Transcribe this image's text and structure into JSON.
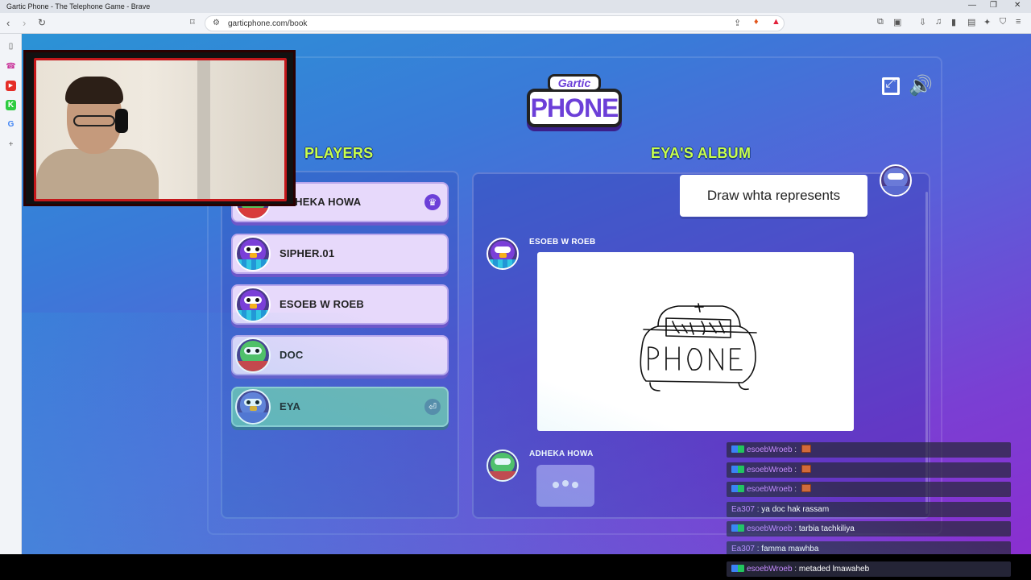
{
  "browser": {
    "window_title": "Gartic Phone - The Telephone Game - Brave",
    "url": "garticphone.com/book",
    "window_controls": {
      "minimize": "—",
      "restore": "❐",
      "close": "✕"
    }
  },
  "game": {
    "logo_top": "Gartic",
    "logo_bottom": "PHONE",
    "players_heading": "PLAYERS",
    "album_heading": "EYA'S ALBUM",
    "players": [
      {
        "name": "ADHEKA HOWA",
        "badge": "♛"
      },
      {
        "name": "SIPHER.01"
      },
      {
        "name": "ESOEB W ROEB"
      },
      {
        "name": "DOC"
      },
      {
        "name": "EYA",
        "badge": "⏎"
      }
    ],
    "album": {
      "prompt": "Draw whta represents",
      "entries": [
        {
          "author": "ESOEB W ROEB",
          "type": "drawing"
        },
        {
          "author": "ADHEKA HOWA",
          "type": "typing"
        }
      ]
    }
  },
  "chat": [
    {
      "user": "esoebWroeb",
      "message": "",
      "emote": true,
      "user_color": "#c58bff"
    },
    {
      "user": "esoebWroeb",
      "message": "",
      "emote": true,
      "user_color": "#c58bff"
    },
    {
      "user": "esoebWroeb",
      "message": "",
      "emote": true,
      "user_color": "#c58bff"
    },
    {
      "user": "Ea307",
      "message": "ya doc hak rassam",
      "emote": false,
      "user_color": "#c58bff"
    },
    {
      "user": "esoebWroeb",
      "message": "tarbia tachkiliya",
      "emote": false,
      "user_color": "#c58bff"
    },
    {
      "user": "Ea307",
      "message": "famma mawhba",
      "emote": false,
      "user_color": "#c58bff"
    },
    {
      "user": "esoebWroeb",
      "message": "metaded lmawaheb",
      "emote": false,
      "user_color": "#c58bff"
    }
  ],
  "colors": {
    "heading": "#c9ff4a",
    "accent": "#6c3fd8",
    "webcam_border": "#c4171a"
  }
}
